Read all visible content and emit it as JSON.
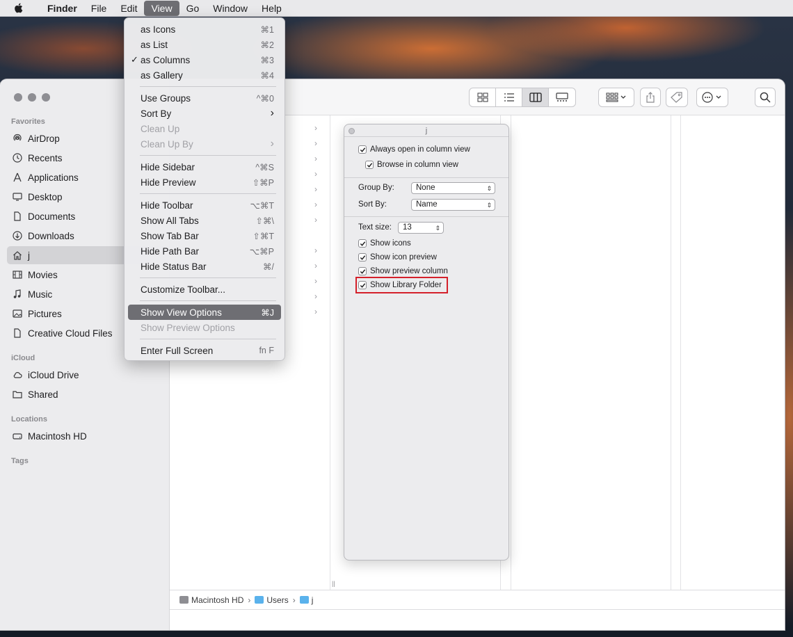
{
  "menubar": {
    "app": "Finder",
    "items": [
      "File",
      "Edit",
      "View",
      "Go",
      "Window",
      "Help"
    ],
    "active": "View"
  },
  "view_menu": {
    "items": [
      {
        "label": "as Icons",
        "shortcut": "⌘1"
      },
      {
        "label": "as List",
        "shortcut": "⌘2"
      },
      {
        "label": "as Columns",
        "shortcut": "⌘3",
        "checked": true
      },
      {
        "label": "as Gallery",
        "shortcut": "⌘4"
      },
      {
        "label": "Use Groups",
        "shortcut": "^⌘0"
      },
      {
        "label": "Sort By",
        "shortcut": "›"
      },
      {
        "label": "Clean Up",
        "shortcut": "",
        "disabled": true
      },
      {
        "label": "Clean Up By",
        "shortcut": "›",
        "disabled": true
      },
      {
        "label": "Hide Sidebar",
        "shortcut": "^⌘S"
      },
      {
        "label": "Hide Preview",
        "shortcut": "⇧⌘P"
      },
      {
        "label": "Hide Toolbar",
        "shortcut": "⌥⌘T"
      },
      {
        "label": "Show All Tabs",
        "shortcut": "⇧⌘\\"
      },
      {
        "label": "Show Tab Bar",
        "shortcut": "⇧⌘T"
      },
      {
        "label": "Hide Path Bar",
        "shortcut": "⌥⌘P"
      },
      {
        "label": "Hide Status Bar",
        "shortcut": "⌘/"
      },
      {
        "label": "Customize Toolbar...",
        "shortcut": ""
      },
      {
        "label": "Show View Options",
        "shortcut": "⌘J",
        "highlighted": true
      },
      {
        "label": "Show Preview Options",
        "shortcut": "",
        "disabled": true
      },
      {
        "label": "Enter Full Screen",
        "shortcut": "fn F"
      }
    ]
  },
  "sidebar": {
    "favorites_header": "Favorites",
    "favorites": [
      {
        "label": "AirDrop",
        "icon": "airdrop-icon"
      },
      {
        "label": "Recents",
        "icon": "clock-icon"
      },
      {
        "label": "Applications",
        "icon": "applications-icon"
      },
      {
        "label": "Desktop",
        "icon": "desktop-icon"
      },
      {
        "label": "Documents",
        "icon": "document-icon"
      },
      {
        "label": "Downloads",
        "icon": "download-icon"
      },
      {
        "label": "j",
        "icon": "home-icon",
        "selected": true
      },
      {
        "label": "Movies",
        "icon": "film-icon"
      },
      {
        "label": "Music",
        "icon": "music-icon"
      },
      {
        "label": "Pictures",
        "icon": "photo-icon"
      },
      {
        "label": "Creative Cloud Files",
        "icon": "file-icon"
      }
    ],
    "icloud_header": "iCloud",
    "icloud": [
      {
        "label": "iCloud Drive",
        "icon": "cloud-icon"
      },
      {
        "label": "Shared",
        "icon": "shared-folder-icon"
      }
    ],
    "locations_header": "Locations",
    "locations": [
      {
        "label": "Macintosh HD",
        "icon": "disk-icon"
      }
    ],
    "tags_header": "Tags"
  },
  "view_options": {
    "title": "j",
    "always_open_column": "Always open in column view",
    "browse_column": "Browse in column view",
    "group_by_label": "Group By:",
    "group_by_value": "None",
    "sort_by_label": "Sort By:",
    "sort_by_value": "Name",
    "text_size_label": "Text size:",
    "text_size_value": "13",
    "show_icons": "Show icons",
    "show_icon_preview": "Show icon preview",
    "show_preview_column": "Show preview column",
    "show_library_folder": "Show Library Folder"
  },
  "pathbar": {
    "crumbs": [
      "Macintosh HD",
      "Users",
      "j"
    ]
  }
}
